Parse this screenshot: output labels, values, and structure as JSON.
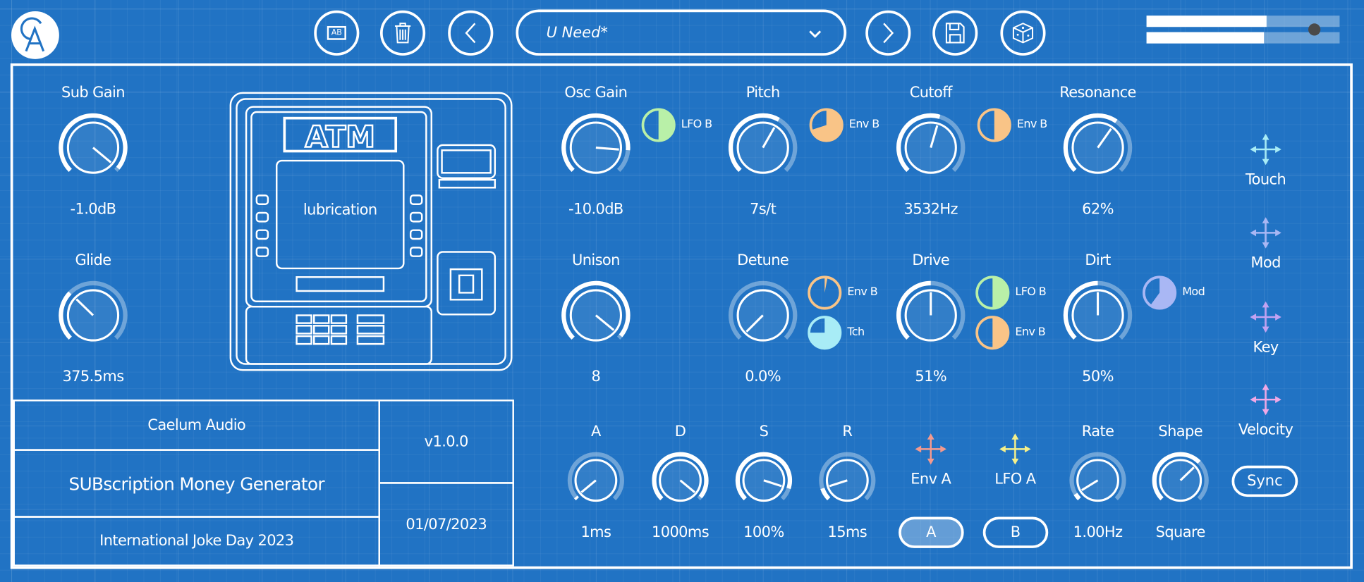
{
  "header": {
    "logo_text": "CA",
    "buttons": {
      "ab": "AB",
      "delete": "delete",
      "prev": "previous",
      "next": "next",
      "save": "save",
      "random": "randomize"
    },
    "preset_name": "U Need*",
    "meters": [
      {
        "level": 0.62
      },
      {
        "level": 0.61
      }
    ],
    "volume_slider": 0.87
  },
  "colors": {
    "bg": "#2173c4",
    "green": "#b9f0a8",
    "orange": "#f9c487",
    "cyan": "#a8ecf6",
    "lavender": "#a9b7f4",
    "purple": "#c2a2f2",
    "pink": "#f0a8e6",
    "salmon": "#f49a8e",
    "yellow": "#f5f08a"
  },
  "knobs": {
    "sub_gain": {
      "label": "Sub Gain",
      "value": "-1.0dB",
      "position": 0.98
    },
    "glide": {
      "label": "Glide",
      "value": "375.5ms",
      "position": 0.33
    },
    "osc_gain": {
      "label": "Osc Gain",
      "value": "-10.0dB",
      "position": 0.85
    },
    "pitch": {
      "label": "Pitch",
      "value": "7s/t",
      "position": 0.61
    },
    "cutoff": {
      "label": "Cutoff",
      "value": "3532Hz",
      "position": 0.56
    },
    "resonance": {
      "label": "Resonance",
      "value": "62%",
      "position": 0.63
    },
    "unison": {
      "label": "Unison",
      "value": "8",
      "position": 0.98
    },
    "detune": {
      "label": "Detune",
      "value": "0.0%",
      "position": 0.0
    },
    "drive": {
      "label": "Drive",
      "value": "51%",
      "position": 0.5
    },
    "dirt": {
      "label": "Dirt",
      "value": "50%",
      "position": 0.5
    },
    "attack": {
      "label": "A",
      "value": "1ms",
      "position": 0.02
    },
    "decay": {
      "label": "D",
      "value": "1000ms",
      "position": 0.98
    },
    "sustain": {
      "label": "S",
      "value": "100%",
      "position": 0.9
    },
    "release": {
      "label": "R",
      "value": "15ms",
      "position": 0.1
    },
    "rate": {
      "label": "Rate",
      "value": "1.00Hz",
      "position": 0.05
    },
    "shape": {
      "label": "Shape",
      "value": "Square",
      "position": 0.67
    }
  },
  "mods": {
    "osc_lfob": {
      "label": "LFO B",
      "amount": 0.5,
      "color": "#b9f0a8"
    },
    "pitch_envb": {
      "label": "Env B",
      "amount": 0.7,
      "color": "#f9c487"
    },
    "cutoff_envb": {
      "label": "Env B",
      "amount": 0.5,
      "color": "#f9c487"
    },
    "detune_envb": {
      "label": "Env B",
      "amount": 0.03,
      "color": "#f9c487"
    },
    "detune_tch": {
      "label": "Tch",
      "amount": 0.75,
      "color": "#a8ecf6"
    },
    "drive_lfob": {
      "label": "LFO B",
      "amount": 0.5,
      "color": "#b9f0a8"
    },
    "drive_envb": {
      "label": "Env B",
      "amount": 0.5,
      "color": "#f9c487"
    },
    "dirt_mod": {
      "label": "Mod",
      "amount": 0.6,
      "color": "#a9b7f4"
    }
  },
  "sources": {
    "touch": "Touch",
    "mod": "Mod",
    "key": "Key",
    "velocity": "Velocity",
    "env_a": "Env A",
    "lfo_a": "LFO A"
  },
  "atm": {
    "title": "ATM",
    "screen_text": "lubrication"
  },
  "info": {
    "company": "Caelum Audio",
    "product": "SUBscription Money Generator",
    "edition": "International Joke Day 2023",
    "version": "v1.0.0",
    "date": "01/07/2023"
  },
  "buttons": {
    "a": "A",
    "b": "B",
    "sync": "Sync"
  }
}
